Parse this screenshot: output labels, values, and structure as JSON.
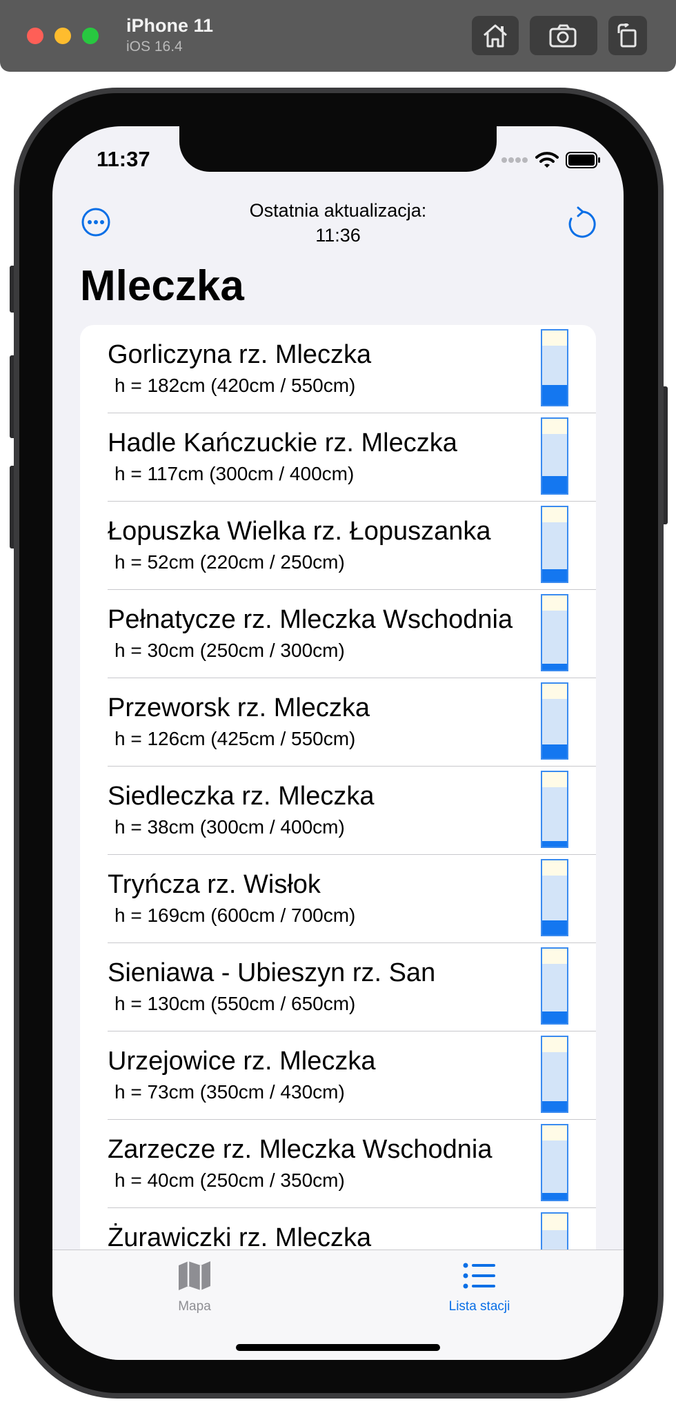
{
  "simulator": {
    "device_name": "iPhone 11",
    "os_version": "iOS 16.4",
    "buttons": [
      "home-icon",
      "screenshot-icon",
      "rotate-icon"
    ]
  },
  "status_bar": {
    "time": "11:37"
  },
  "nav": {
    "title_line1": "Ostatnia aktualizacja:",
    "title_line2": "11:36",
    "left_icon": "ellipsis-circle-icon",
    "right_icon": "refresh-icon"
  },
  "page": {
    "title": "Mleczka"
  },
  "stations": [
    {
      "name": "Gorliczyna rz. Mleczka",
      "detail": "h = 182cm (420cm / 550cm)",
      "level": 182,
      "warning": 420,
      "alarm": 550
    },
    {
      "name": "Hadle Kańczuckie rz. Mleczka",
      "detail": "h = 117cm (300cm / 400cm)",
      "level": 117,
      "warning": 300,
      "alarm": 400
    },
    {
      "name": "Łopuszka Wielka rz. Łopuszanka",
      "detail": "h = 52cm (220cm / 250cm)",
      "level": 52,
      "warning": 220,
      "alarm": 250
    },
    {
      "name": "Pełnatycze rz. Mleczka Wschodnia",
      "detail": "h = 30cm (250cm / 300cm)",
      "level": 30,
      "warning": 250,
      "alarm": 300
    },
    {
      "name": "Przeworsk rz. Mleczka",
      "detail": "h = 126cm (425cm / 550cm)",
      "level": 126,
      "warning": 425,
      "alarm": 550
    },
    {
      "name": "Siedleczka rz. Mleczka",
      "detail": "h = 38cm (300cm / 400cm)",
      "level": 38,
      "warning": 300,
      "alarm": 400
    },
    {
      "name": "Tryńcza rz. Wisłok",
      "detail": "h = 169cm (600cm / 700cm)",
      "level": 169,
      "warning": 600,
      "alarm": 700
    },
    {
      "name": "Sieniawa - Ubieszyn rz. San",
      "detail": "h = 130cm (550cm / 650cm)",
      "level": 130,
      "warning": 550,
      "alarm": 650
    },
    {
      "name": "Urzejowice rz. Mleczka",
      "detail": "h = 73cm (350cm / 430cm)",
      "level": 73,
      "warning": 350,
      "alarm": 430
    },
    {
      "name": "Zarzecze rz. Mleczka Wschodnia",
      "detail": "h = 40cm (250cm / 350cm)",
      "level": 40,
      "warning": 250,
      "alarm": 350
    },
    {
      "name": "Żurawiczki rz. Mleczka",
      "detail": "",
      "level": 0,
      "warning": 0,
      "alarm": 0
    }
  ],
  "tabs": [
    {
      "label": "Mapa",
      "icon": "map-icon",
      "selected": false
    },
    {
      "label": "Lista stacji",
      "icon": "list-icon",
      "selected": true
    }
  ],
  "colors": {
    "accent": "#0a6fe6",
    "gauge_level": "#1477f0",
    "gauge_warning_zone": "#d3e4f8",
    "gauge_alarm_zone": "#fffbe7",
    "background": "#f2f2f7"
  }
}
